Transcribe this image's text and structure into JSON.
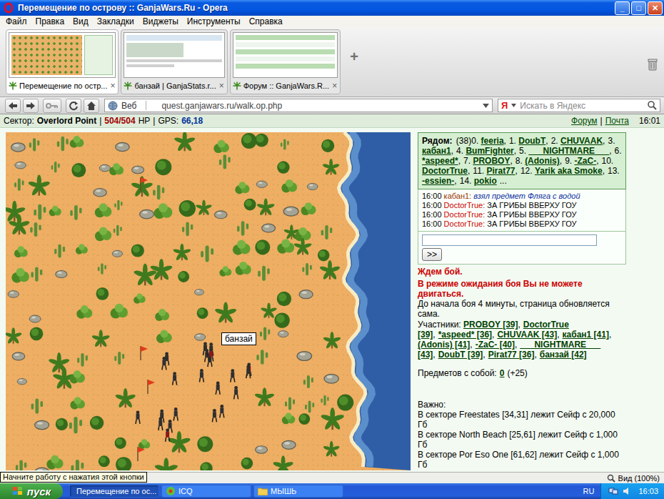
{
  "window": {
    "title": "Перемещение по острову :: GanjaWars.Ru - Opera",
    "controls": [
      {
        "glyph": "_",
        "kind": "minimize"
      },
      {
        "glyph": "□",
        "kind": "maximize"
      },
      {
        "glyph": "✕",
        "kind": "close"
      }
    ]
  },
  "menu": [
    "Файл",
    "Правка",
    "Вид",
    "Закладки",
    "Виджеты",
    "Инструменты",
    "Справка"
  ],
  "tabs": [
    {
      "label": "Перемещение по остр...",
      "selected": true,
      "kind": "map"
    },
    {
      "label": "банзай | GanjaStats.r...",
      "selected": false,
      "kind": "stats"
    },
    {
      "label": "Форум :: GanjaWars.R...",
      "selected": false,
      "kind": "forum"
    }
  ],
  "tab_close": "×",
  "new_tab": "+",
  "toolbar": {
    "web_label": "Веб",
    "url": "quest.ganjawars.ru/walk.op.php",
    "search_engine": "Я",
    "search_placeholder": "Искать в Яндекс"
  },
  "header": {
    "sector_label": "Сектор:",
    "sector": "Overlord Point",
    "separator": "|",
    "hp": "504/504",
    "hp_unit": "HP",
    "gps_label": "GPS:",
    "gps": "66,18",
    "links": [
      "Форум",
      "Почта"
    ],
    "time": "16:01"
  },
  "map": {
    "marker": "банзай",
    "units": 22
  },
  "nearby": {
    "label": "Рядом:",
    "count": "(38)",
    "separator": ",",
    "more": "...",
    "players": [
      {
        "num": "0.",
        "name": "feeria"
      },
      {
        "num": "1.",
        "name": "DoubT"
      },
      {
        "num": "2.",
        "name": "CHUVAAK"
      },
      {
        "num": "3.",
        "name": "кабан1"
      },
      {
        "num": "4.",
        "name": "BumFighter"
      },
      {
        "num": "5.",
        "name": "___NIGHTMARE___"
      },
      {
        "num": "6.",
        "name": "*aspeed*"
      },
      {
        "num": "7.",
        "name": "PROBOY"
      },
      {
        "num": "8.",
        "name": "(Adonis)"
      },
      {
        "num": "9.",
        "name": "-ZaC-"
      },
      {
        "num": "10.",
        "name": "DoctorTrue"
      },
      {
        "num": "11.",
        "name": "Pirat77"
      },
      {
        "num": "12.",
        "name": "Yarik aka Smoke"
      },
      {
        "num": "13.",
        "name": "-essien-"
      },
      {
        "num": "14.",
        "name": "pokio"
      }
    ]
  },
  "chat": [
    {
      "time": "16:00",
      "author": "кабан1:",
      "text": "взял предмет Фляга с водой",
      "kind": "event",
      "color": "#993300"
    },
    {
      "time": "16:00",
      "author": "DoctorTrue:",
      "text": "ЗА ГРИБЫ ВВЕРХУ ГОУ",
      "kind": "message",
      "color": "#cc0000"
    },
    {
      "time": "16:00",
      "author": "DoctorTrue:",
      "text": "ЗА ГРИБЫ ВВЕРХУ ГОУ",
      "kind": "message",
      "color": "#cc0000"
    },
    {
      "time": "16:00",
      "author": "DoctorTrue:",
      "text": "ЗА ГРИБЫ ВВЕРХУ ГОУ",
      "kind": "message",
      "color": "#cc0000"
    }
  ],
  "chat_input": {
    "value": "",
    "button": ">>"
  },
  "battle": {
    "status": "Ждем бой.",
    "warning": "В режиме ожидания боя Вы не можете двигаться.",
    "countdown": "До начала боя 4 минуты, страница обновляется сама.",
    "participants_label": "Участники:",
    "separator": ",",
    "participants": [
      {
        "name": "PROBOY",
        "level": "[39]"
      },
      {
        "name": "DoctorTrue",
        "level": "[39]"
      },
      {
        "name": "*aspeed*",
        "level": "[36]"
      },
      {
        "name": "CHUVAAK",
        "level": "[43]"
      },
      {
        "name": "кабан1",
        "level": "[41]"
      },
      {
        "name": "(Adonis)",
        "level": "[41]"
      },
      {
        "name": "-ZaC-",
        "level": "[40]"
      },
      {
        "name": "___NIGHTMARE___",
        "level": "[43]"
      },
      {
        "name": "DoubT",
        "level": "[39]"
      },
      {
        "name": "Pirat77",
        "level": "[36]"
      },
      {
        "name": "банзай",
        "level": "[42]"
      }
    ]
  },
  "items": {
    "label": "Предметов с собой:",
    "count": "0",
    "bonus": "(+25)"
  },
  "notice": {
    "title": "Важно:",
    "lines": [
      "В секторе Freestates [34,31] лежит Сейф с 20,000 Гб",
      "В секторе North Beach [25,61] лежит Сейф с 1,000 Гб",
      "В секторе Por Eso One [61,62] лежит Сейф с 1,000 Гб"
    ]
  },
  "tooltip": "Начните работу с нажатия этой кнопки",
  "statusbar": {
    "zoom": "Вид (100%)"
  },
  "taskbar": {
    "start": "пуск",
    "tasks": [
      {
        "label": "Перемещение по ос...",
        "selected": true,
        "kind": "opera"
      },
      {
        "label": "ICQ",
        "selected": false,
        "kind": "icq"
      },
      {
        "label": "МЫШЬ",
        "selected": false,
        "kind": "folder"
      }
    ],
    "lang": "RU",
    "time": "16:03"
  }
}
